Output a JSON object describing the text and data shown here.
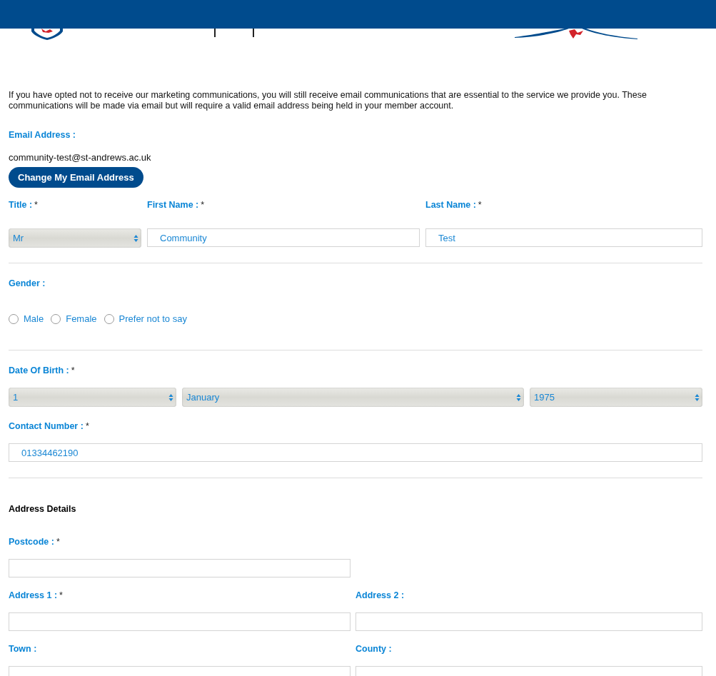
{
  "intro": "If you have opted not to receive our marketing communications, you will still receive email communications that are essential to the service we provide you. These communications will be made via email but will require a valid email address being held in your member account.",
  "email": {
    "label": "Email Address :",
    "value": "community-test@st-andrews.ac.uk",
    "button": "Change My Email Address"
  },
  "name_row": [
    {
      "kind": "select",
      "label": "Title :",
      "required_mark": "*",
      "value": "Mr"
    },
    {
      "kind": "text",
      "label": "First Name :",
      "required_mark": "*",
      "value": "Community"
    },
    {
      "kind": "text",
      "label": "Last Name :",
      "required_mark": "*",
      "value": "Test"
    }
  ],
  "gender": {
    "label": "Gender :",
    "options": [
      {
        "label": "Male",
        "selected": false
      },
      {
        "label": "Female",
        "selected": false
      },
      {
        "label": "Prefer not to say",
        "selected": false
      }
    ]
  },
  "date_of_birth": {
    "label": "Date Of Birth :",
    "required_mark": "*",
    "selects": [
      "1",
      "January",
      "1975"
    ]
  },
  "contact": {
    "label": "Contact Number :",
    "required_mark": "*",
    "value": "01334462190"
  },
  "address": {
    "heading": "Address Details",
    "postcode": {
      "label": "Postcode :",
      "required_mark": "*"
    },
    "rows": [
      [
        {
          "label": "Address 1 :",
          "required_mark": "*"
        },
        {
          "label": "Address 2 :"
        }
      ],
      [
        {
          "label": "Town :"
        },
        {
          "label": "County :"
        }
      ]
    ]
  }
}
